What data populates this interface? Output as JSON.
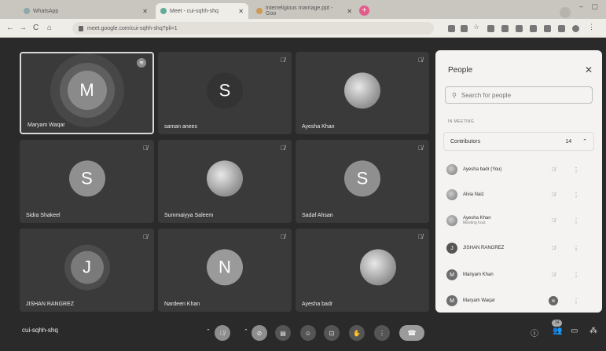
{
  "browser": {
    "tabs": [
      {
        "title": "WhatsApp"
      },
      {
        "title": "Meet - cui-sqhh-shq"
      },
      {
        "title": "interreligious marriage.ppt - Goo"
      }
    ],
    "new_tab": "+",
    "url": "meet.google.com/cui-sqhh-shq?pli=1"
  },
  "tiles": [
    {
      "name": "Maryam Waqar",
      "initial": "M",
      "kind": "letter",
      "color": "#8a8a8a"
    },
    {
      "name": "saman anees",
      "initial": "S",
      "kind": "letter",
      "color": "#3a3a3a"
    },
    {
      "name": "Ayesha Khan",
      "initial": "",
      "kind": "photo",
      "color": "#777777"
    },
    {
      "name": "Sidra Shakeel",
      "initial": "S",
      "kind": "letter",
      "color": "#8f8f8f"
    },
    {
      "name": "Summaiyya Saleem",
      "initial": "",
      "kind": "photo",
      "color": "#777777"
    },
    {
      "name": "Sadaf Ahsan",
      "initial": "S",
      "kind": "letter",
      "color": "#8f8f8f"
    },
    {
      "name": "JISHAN RANGREZ",
      "initial": "J",
      "kind": "letter",
      "color": "#7a7a7a"
    },
    {
      "name": "Nardeen Khan",
      "initial": "N",
      "kind": "letter",
      "color": "#9a9a9a"
    },
    {
      "name": "Ayesha badr",
      "initial": "",
      "kind": "photo",
      "color": "#777777"
    }
  ],
  "people_panel": {
    "title": "People",
    "search_placeholder": "Search for people",
    "section": "IN MEETING",
    "group": {
      "label": "Contributors",
      "count": "14"
    },
    "members": [
      {
        "name": "Ayesha badr (You)",
        "sub": "",
        "initial": "",
        "avatar": "photo"
      },
      {
        "name": "Alvia Naiz",
        "sub": "",
        "initial": "",
        "avatar": "photo"
      },
      {
        "name": "Ayesha Khan",
        "sub": "Meeting host",
        "initial": "",
        "avatar": "photo"
      },
      {
        "name": "JISHAN RANGREZ",
        "sub": "",
        "initial": "J",
        "avatar": "letter"
      },
      {
        "name": "Mariyam Khan",
        "sub": "",
        "initial": "M",
        "avatar": "letter"
      },
      {
        "name": "Maryam Waqar",
        "sub": "",
        "initial": "M",
        "avatar": "letter"
      }
    ]
  },
  "toolbar": {
    "meeting_code": "cui-sqhh-shq",
    "participant_badge": "14"
  }
}
